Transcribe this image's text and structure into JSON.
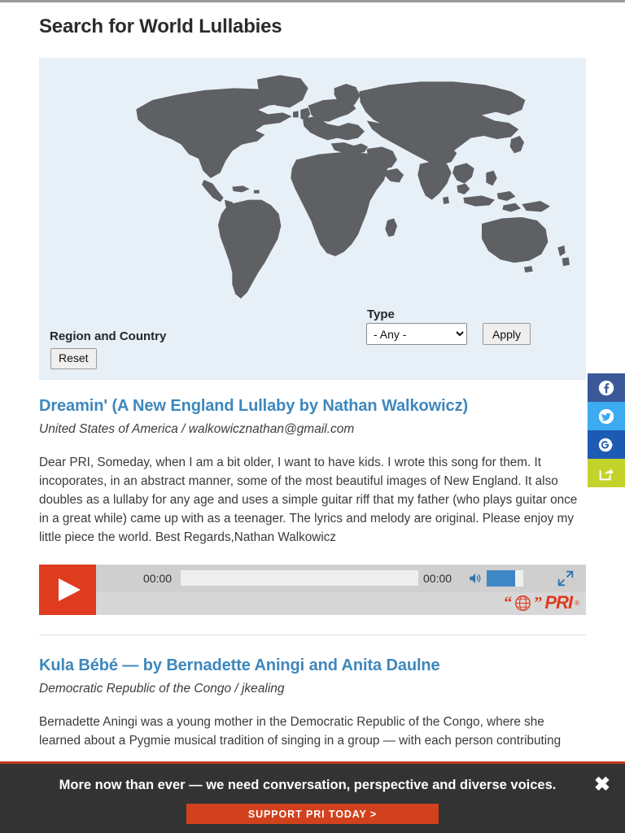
{
  "page": {
    "title": "Search for World Lullabies"
  },
  "search_panel": {
    "map_alt": "world-map",
    "region_label": "Region and Country",
    "reset_label": "Reset",
    "type_label": "Type",
    "type_selected": "- Any -",
    "type_options": [
      "- Any -"
    ],
    "apply_label": "Apply"
  },
  "results": [
    {
      "title": "Dreamin' (A New England Lullaby by Nathan Walkowicz)",
      "meta": "United States of America / walkowicznathan@gmail.com",
      "body": " Dear PRI,      Someday, when I am a bit older, I want to have kids. I wrote this song for them. It incoporates, in an abstract manner, some of the most beautiful images of New England. It also doubles as a lullaby for any age and uses a simple guitar riff that my father (who plays guitar once in a great while) came up with as a teenager. The lyrics and melody are original. Please enjoy my little piece the world. Best Regards,Nathan Walkowicz",
      "player": {
        "current_time": "00:00",
        "duration": "00:00",
        "brand": "PRI",
        "brand_registered": "®"
      }
    },
    {
      "title": "Kula Bébé — by Bernadette Aningi and Anita Daulne",
      "meta": "Democratic Republic of the Congo / jkealing",
      "body": "Bernadette Aningi was a young mother in the Democratic Republic of the Congo, where she learned about a Pygmie musical tradition of singing in a group — with each person contributing"
    }
  ],
  "social": {
    "items": [
      {
        "name": "facebook",
        "icon": "facebook-icon",
        "color": "#3b5998"
      },
      {
        "name": "twitter",
        "icon": "twitter-icon",
        "color": "#3dabf0"
      },
      {
        "name": "google-plus",
        "icon": "google-plus-icon",
        "color": "#1d5ab4"
      },
      {
        "name": "share",
        "icon": "share-icon",
        "color": "#c4d32c"
      }
    ]
  },
  "banner": {
    "message": "More now than ever — we need conversation, perspective and diverse voices.",
    "cta_label": "SUPPORT PRI TODAY >",
    "close_label": "✖"
  },
  "colors": {
    "accent_red": "#de3b1f",
    "link_blue": "#3e87bd",
    "panel_bg": "#e7eff7",
    "map_land": "#5e6063",
    "banner_bg": "#333333",
    "cta_red": "#d2411d"
  }
}
